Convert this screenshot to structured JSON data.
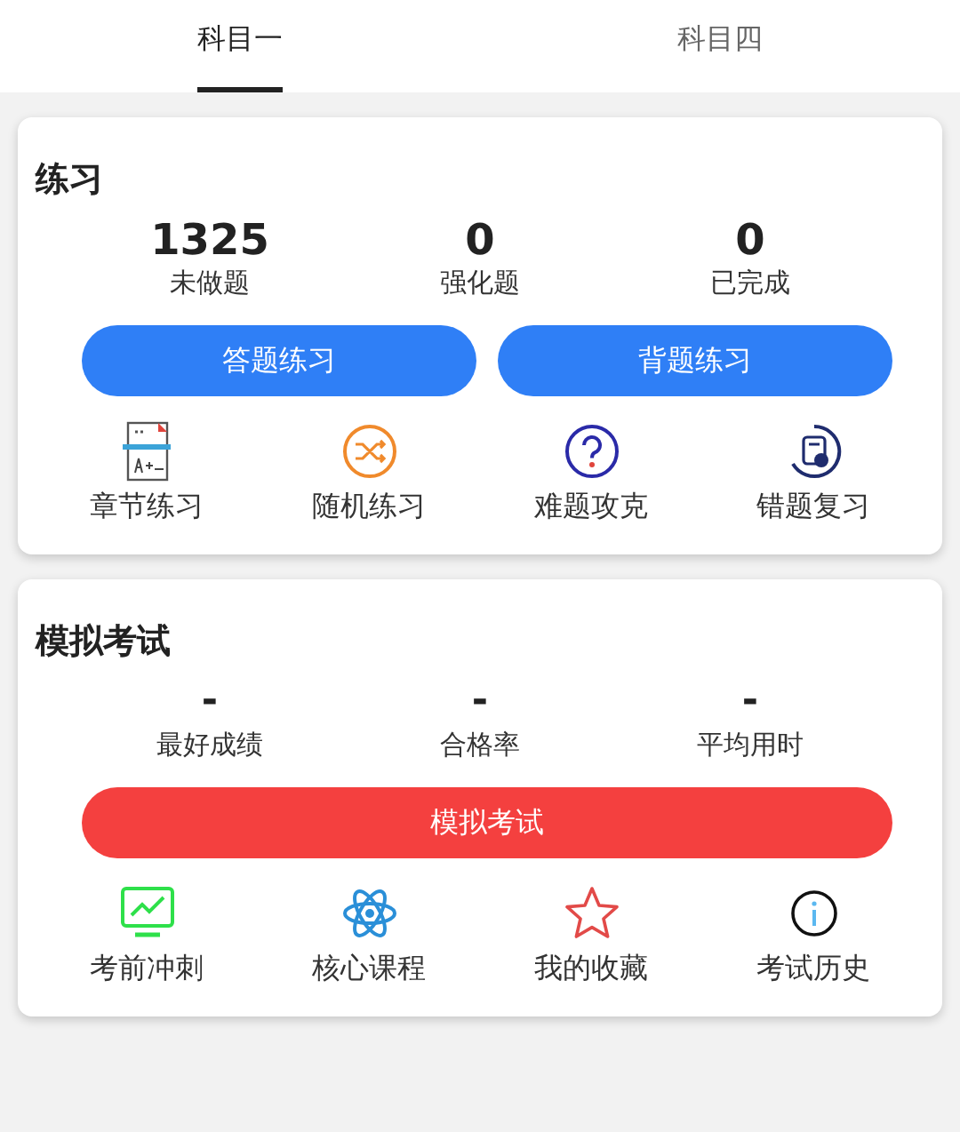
{
  "tabs": [
    {
      "label": "科目一",
      "selected": true
    },
    {
      "label": "科目四",
      "selected": false
    }
  ],
  "practice": {
    "title": "练习",
    "stats": [
      {
        "value": "1325",
        "label": "未做题"
      },
      {
        "value": "0",
        "label": "强化题"
      },
      {
        "value": "0",
        "label": "已完成"
      }
    ],
    "buttons": [
      "答题练习",
      "背题练习"
    ],
    "shortcuts": [
      "章节练习",
      "随机练习",
      "难题攻克",
      "错题复习"
    ]
  },
  "exam": {
    "title": "模拟考试",
    "stats": [
      {
        "value": "-",
        "label": "最好成绩"
      },
      {
        "value": "-",
        "label": "合格率"
      },
      {
        "value": "-",
        "label": "平均用时"
      }
    ],
    "buttons": [
      "模拟考试"
    ],
    "shortcuts": [
      "考前冲刺",
      "核心课程",
      "我的收藏",
      "考试历史"
    ]
  }
}
